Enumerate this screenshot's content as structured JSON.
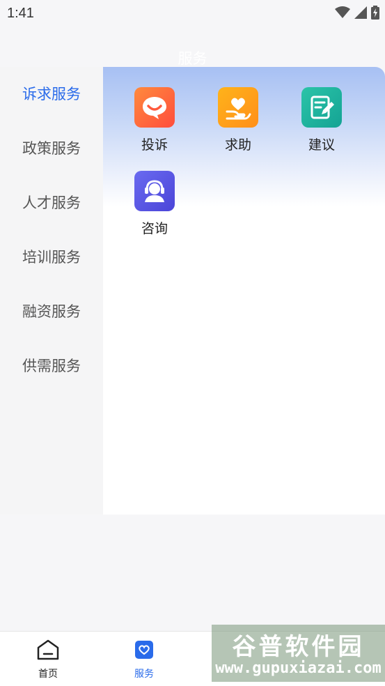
{
  "status_bar": {
    "time": "1:41"
  },
  "header": {
    "title": "服务"
  },
  "sidebar": {
    "items": [
      {
        "label": "诉求服务",
        "active": true
      },
      {
        "label": "政策服务",
        "active": false
      },
      {
        "label": "人才服务",
        "active": false
      },
      {
        "label": "培训服务",
        "active": false
      },
      {
        "label": "融资服务",
        "active": false
      },
      {
        "label": "供需服务",
        "active": false
      }
    ]
  },
  "services": [
    {
      "label": "投诉",
      "icon": "chat-smile-icon",
      "color": "#ff6a3d"
    },
    {
      "label": "求助",
      "icon": "heart-hand-icon",
      "color": "#ff9f1a"
    },
    {
      "label": "建议",
      "icon": "note-edit-icon",
      "color": "#1fb5a3"
    },
    {
      "label": "咨询",
      "icon": "headset-person-icon",
      "color": "#5a55e6"
    }
  ],
  "tabbar": {
    "tabs": [
      {
        "label": "首页",
        "icon": "home-icon",
        "active": false
      },
      {
        "label": "服务",
        "icon": "heart-bag-icon",
        "active": true
      }
    ]
  },
  "watermark": {
    "title": "谷普软件园",
    "url": "www.gupuxiazai.com"
  },
  "colors": {
    "accent": "#2a6bea",
    "sidebar_bg": "#f5f5f6",
    "page_bg": "#f6f6f8"
  }
}
